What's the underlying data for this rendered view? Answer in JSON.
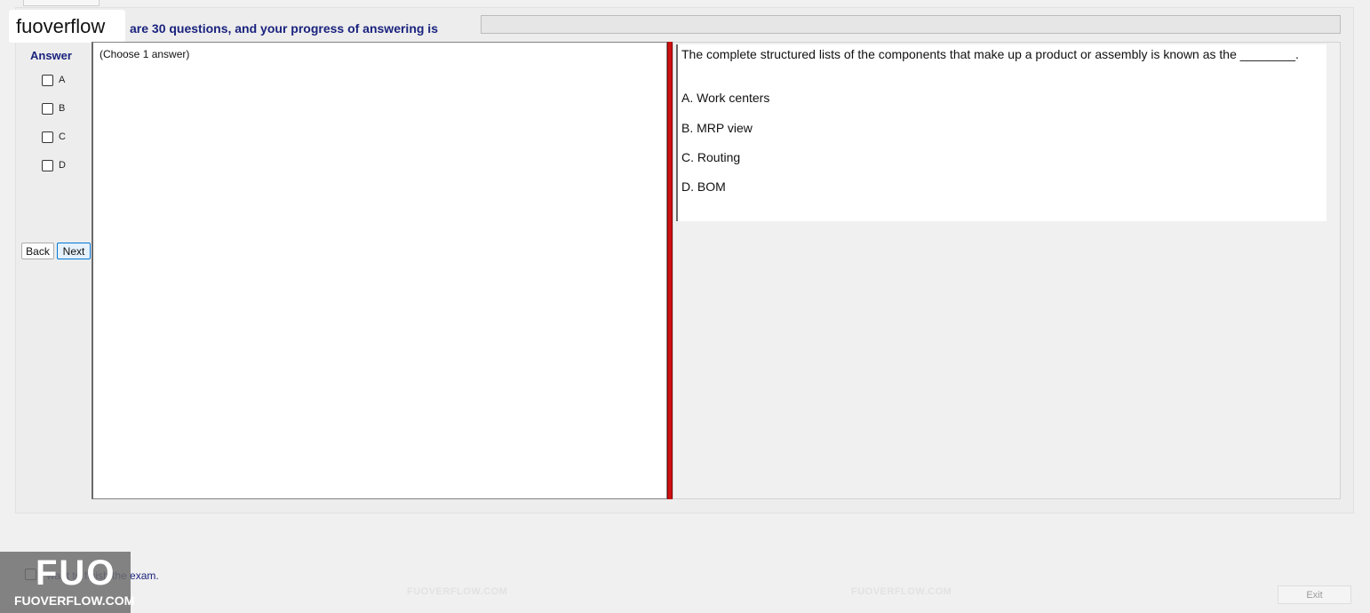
{
  "header": {
    "progress_text": "are 30 questions, and your progress of answering is",
    "progress_percent": 0,
    "logo_text": "fuoverflow"
  },
  "answer": {
    "heading": "Answer",
    "options": [
      {
        "label": "A",
        "checked": false
      },
      {
        "label": "B",
        "checked": false
      },
      {
        "label": "C",
        "checked": false
      },
      {
        "label": "D",
        "checked": false
      }
    ],
    "back_label": "Back",
    "next_label": "Next",
    "choose_hint": "(Choose 1 answer)"
  },
  "question": {
    "text": "The complete structured lists of the components that make up a product or assembly is known as the ________.",
    "choices": [
      "A.  Work centers",
      "B.  MRP view",
      "C.  Routing",
      "D.  BOM"
    ]
  },
  "footer": {
    "finish_label": "I want to finish the exam.",
    "exit_label": "Exit",
    "logo_big": "FUO",
    "logo_small": "FUOVERFLOW.COM"
  },
  "watermark": {
    "text": "FUOVERFLOW.COM"
  },
  "colors": {
    "accent_text": "#1a237e",
    "splitter": "#cc1111"
  }
}
